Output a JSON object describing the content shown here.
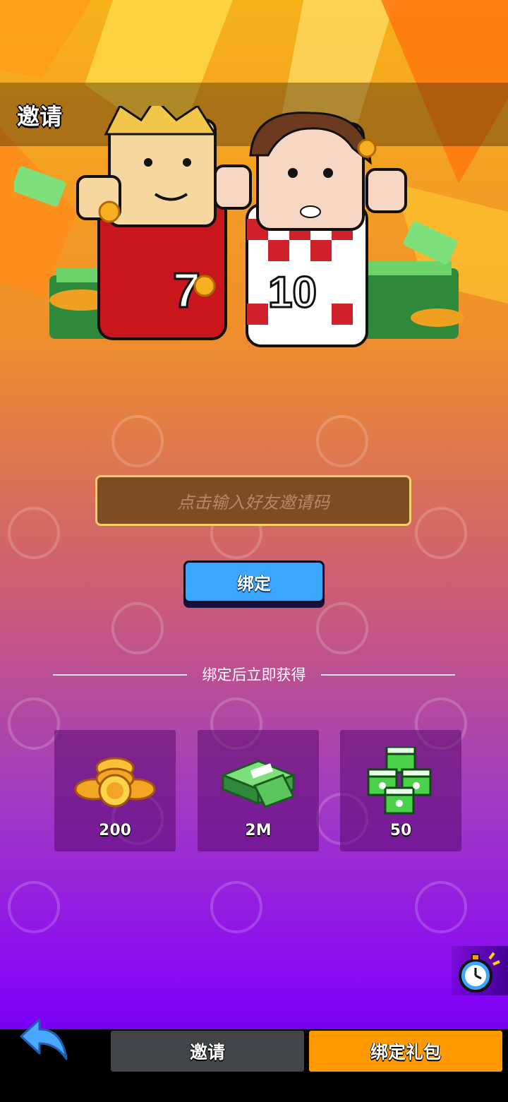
{
  "header": {
    "title": "邀请"
  },
  "form": {
    "input_placeholder": "点击输入好友邀请码",
    "bind_label": "绑定"
  },
  "rewards": {
    "heading": "绑定后立即获得",
    "items": [
      {
        "icon": "gold-coins-icon",
        "value": "200"
      },
      {
        "icon": "cash-stack-icon",
        "value": "2M"
      },
      {
        "icon": "green-cubes-icon",
        "value": "50"
      }
    ]
  },
  "bottom_tabs": [
    {
      "label": "邀请",
      "active": false
    },
    {
      "label": "绑定礼包",
      "active": true
    }
  ],
  "colors": {
    "accent_orange": "#ff9a00",
    "bind_blue": "#3aa6ff",
    "tab_inactive": "#414548"
  },
  "icons": {
    "back": "back-arrow-icon",
    "timer": "stopwatch-icon"
  }
}
